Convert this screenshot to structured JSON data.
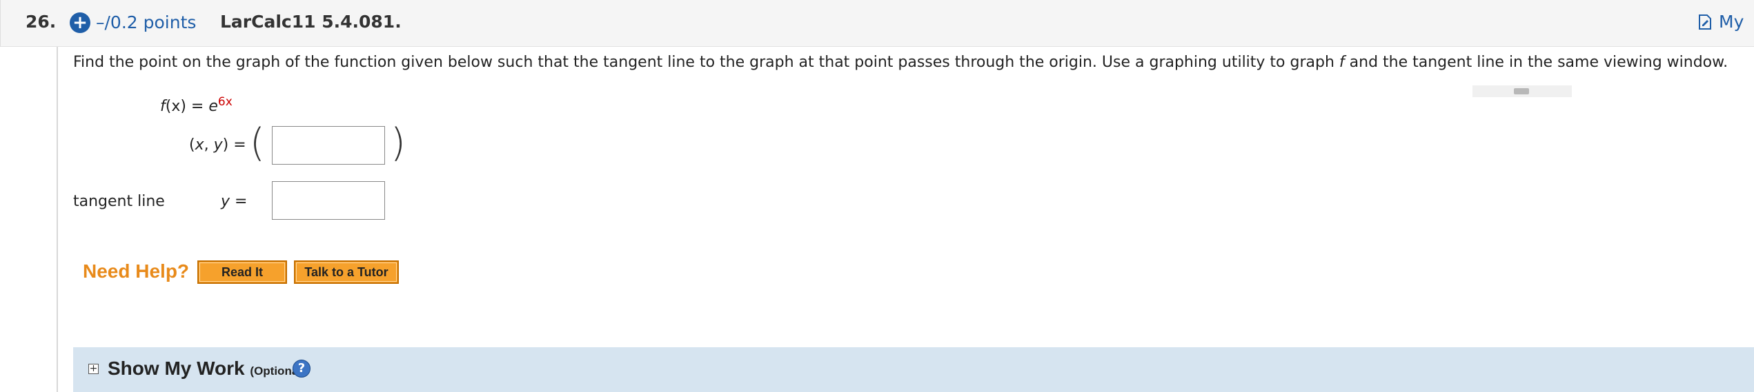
{
  "header": {
    "question_number": "26.",
    "add_icon": "plus-circle-icon",
    "points": "–/0.2 points",
    "question_id": "LarCalc11 5.4.081.",
    "my_notes_label": "My",
    "my_notes_icon": "note-edit-icon"
  },
  "problem": {
    "prompt_part1": "Find the point on the graph of the function given below such that the tangent line to the graph at that point passes through the origin. Use a graphing utility to graph ",
    "prompt_var": "f",
    "prompt_part2": " and the tangent line in the same viewing window.",
    "function_lhs_f": "f",
    "function_lhs_rest": "(x) = ",
    "function_base": "e",
    "function_exponent": "6x",
    "point_label_x": "x",
    "point_label_sep": ", ",
    "point_label_y": "y",
    "point_label_eq": ") =",
    "point_value": "",
    "tangent_label": "tangent line",
    "tangent_var": "y",
    "tangent_eq": " =",
    "tangent_value": ""
  },
  "help": {
    "label": "Need Help?",
    "read_it": "Read It",
    "tutor": "Talk to a Tutor"
  },
  "show_work": {
    "toggle": "+",
    "title": "Show My Work",
    "optional": "(Optional)",
    "help_glyph": "?"
  }
}
